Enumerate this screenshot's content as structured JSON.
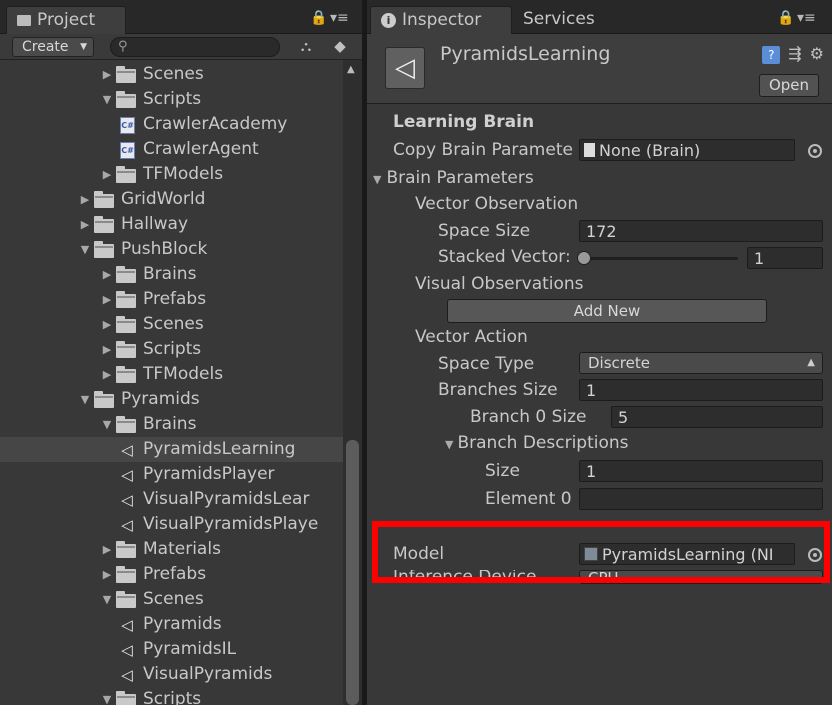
{
  "project_panel": {
    "tab_title": "Project",
    "create_label": "Create",
    "search_placeholder": "",
    "tree": [
      {
        "label": "Scenes",
        "type": "folder",
        "expanded": false
      },
      {
        "label": "Scripts",
        "type": "folder",
        "expanded": true
      },
      {
        "label": "CrawlerAcademy",
        "type": "cs"
      },
      {
        "label": "CrawlerAgent",
        "type": "cs"
      },
      {
        "label": "TFModels",
        "type": "folder",
        "expanded": false
      },
      {
        "label": "GridWorld",
        "type": "folder",
        "expanded": false
      },
      {
        "label": "Hallway",
        "type": "folder",
        "expanded": false
      },
      {
        "label": "PushBlock",
        "type": "folder",
        "expanded": true
      },
      {
        "label": "Brains",
        "type": "folder",
        "expanded": false
      },
      {
        "label": "Prefabs",
        "type": "folder",
        "expanded": false
      },
      {
        "label": "Scenes",
        "type": "folder",
        "expanded": false
      },
      {
        "label": "Scripts",
        "type": "folder",
        "expanded": false
      },
      {
        "label": "TFModels",
        "type": "folder",
        "expanded": false
      },
      {
        "label": "Pyramids",
        "type": "folder",
        "expanded": true
      },
      {
        "label": "Brains",
        "type": "folder",
        "expanded": true
      },
      {
        "label": "PyramidsLearning",
        "type": "unity",
        "selected": true
      },
      {
        "label": "PyramidsPlayer",
        "type": "unity"
      },
      {
        "label": "VisualPyramidsLear",
        "type": "unity"
      },
      {
        "label": "VisualPyramidsPlaye",
        "type": "unity"
      },
      {
        "label": "Materials",
        "type": "folder",
        "expanded": false
      },
      {
        "label": "Prefabs",
        "type": "folder",
        "expanded": false
      },
      {
        "label": "Scenes",
        "type": "folder",
        "expanded": true
      },
      {
        "label": "Pyramids",
        "type": "unity"
      },
      {
        "label": "PyramidsIL",
        "type": "unity"
      },
      {
        "label": "VisualPyramids",
        "type": "unity"
      },
      {
        "label": "Scripts",
        "type": "folder",
        "expanded": true
      }
    ]
  },
  "inspector": {
    "tab_title": "Inspector",
    "services_tab": "Services",
    "object_name": "PyramidsLearning",
    "open_label": "Open",
    "section_title": "Learning Brain",
    "copy_brain_label": "Copy Brain Paramete",
    "copy_brain_value": "None (Brain)",
    "brain_parameters_label": "Brain Parameters",
    "vector_observation_label": "Vector Observation",
    "space_size_label": "Space Size",
    "space_size_value": "172",
    "stacked_vectors_label": "Stacked Vector:",
    "stacked_vectors_value": "1",
    "visual_observations_label": "Visual Observations",
    "add_new_label": "Add New",
    "vector_action_label": "Vector Action",
    "space_type_label": "Space Type",
    "space_type_value": "Discrete",
    "branches_size_label": "Branches Size",
    "branches_size_value": "1",
    "branch0_size_label": "Branch 0 Size",
    "branch0_size_value": "5",
    "branch_descriptions_label": "Branch Descriptions",
    "size_label": "Size",
    "size_value": "1",
    "element0_label": "Element 0",
    "element0_value": "",
    "model_label": "Model",
    "model_value": "PyramidsLearning (NI",
    "inference_device_label": "Inference Device",
    "inference_device_value": "CPU"
  },
  "colors": {
    "highlight": "#ff0000",
    "selection": "#464646",
    "panel_bg": "#383838"
  }
}
